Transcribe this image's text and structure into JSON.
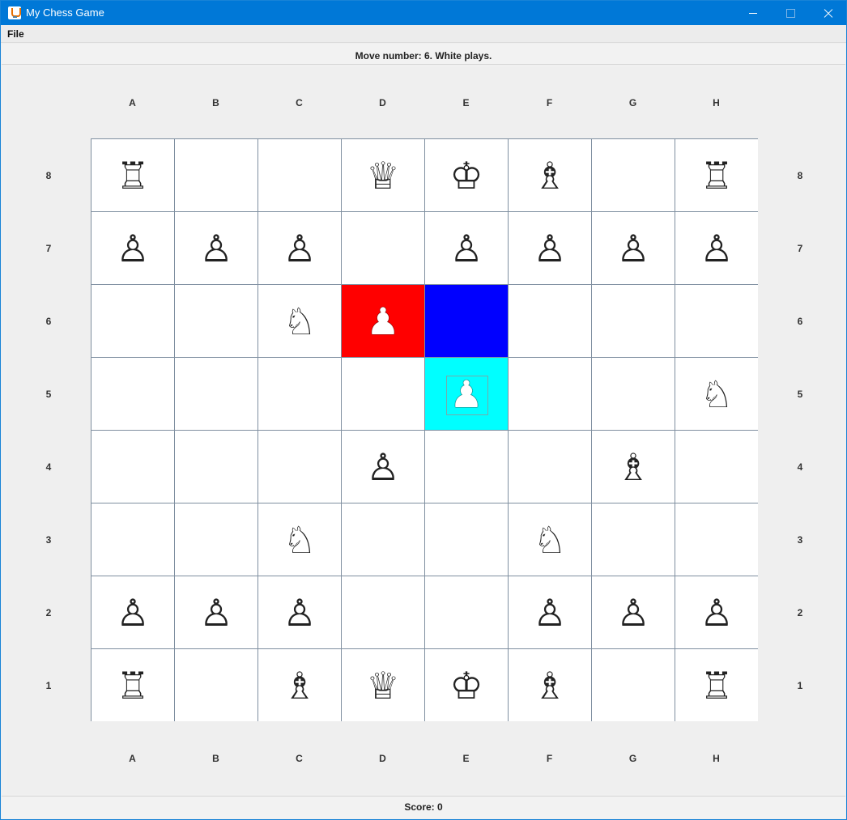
{
  "window": {
    "title": "My Chess Game"
  },
  "menu": {
    "file": "File"
  },
  "status": {
    "move": "Move number: 6. White plays.",
    "score": "Score: 0"
  },
  "board": {
    "columns": [
      "A",
      "B",
      "C",
      "D",
      "E",
      "F",
      "G",
      "H"
    ],
    "rows": [
      "8",
      "7",
      "6",
      "5",
      "4",
      "3",
      "2",
      "1"
    ],
    "highlight_colors": {
      "selected": "#ff0000",
      "target": "#0000ff",
      "threatened": "#00ffff"
    },
    "squares": [
      {
        "sq": "A8",
        "piece": "rook",
        "glyph": "♖"
      },
      {
        "sq": "D8",
        "piece": "queen",
        "glyph": "♕"
      },
      {
        "sq": "E8",
        "piece": "king",
        "glyph": "♔"
      },
      {
        "sq": "F8",
        "piece": "bishop",
        "glyph": "♗"
      },
      {
        "sq": "H8",
        "piece": "rook",
        "glyph": "♖"
      },
      {
        "sq": "A7",
        "piece": "pawn",
        "glyph": "♙"
      },
      {
        "sq": "B7",
        "piece": "pawn",
        "glyph": "♙"
      },
      {
        "sq": "C7",
        "piece": "pawn",
        "glyph": "♙"
      },
      {
        "sq": "E7",
        "piece": "pawn",
        "glyph": "♙"
      },
      {
        "sq": "F7",
        "piece": "pawn",
        "glyph": "♙"
      },
      {
        "sq": "G7",
        "piece": "pawn",
        "glyph": "♙"
      },
      {
        "sq": "H7",
        "piece": "pawn",
        "glyph": "♙"
      },
      {
        "sq": "C6",
        "piece": "knight",
        "glyph": "♘"
      },
      {
        "sq": "D6",
        "piece": "pawn",
        "glyph": "♟",
        "highlight": "selected"
      },
      {
        "sq": "E6",
        "piece": "",
        "glyph": "",
        "highlight": "target"
      },
      {
        "sq": "E5",
        "piece": "pawn",
        "glyph": "♟",
        "highlight": "threatened"
      },
      {
        "sq": "H5",
        "piece": "knight",
        "glyph": "♘"
      },
      {
        "sq": "D4",
        "piece": "pawn",
        "glyph": "♙"
      },
      {
        "sq": "G4",
        "piece": "bishop",
        "glyph": "♗"
      },
      {
        "sq": "C3",
        "piece": "knight",
        "glyph": "♘"
      },
      {
        "sq": "F3",
        "piece": "knight",
        "glyph": "♘"
      },
      {
        "sq": "A2",
        "piece": "pawn",
        "glyph": "♙"
      },
      {
        "sq": "B2",
        "piece": "pawn",
        "glyph": "♙"
      },
      {
        "sq": "C2",
        "piece": "pawn",
        "glyph": "♙"
      },
      {
        "sq": "F2",
        "piece": "pawn",
        "glyph": "♙"
      },
      {
        "sq": "G2",
        "piece": "pawn",
        "glyph": "♙"
      },
      {
        "sq": "H2",
        "piece": "pawn",
        "glyph": "♙"
      },
      {
        "sq": "A1",
        "piece": "rook",
        "glyph": "♖"
      },
      {
        "sq": "C1",
        "piece": "bishop",
        "glyph": "♗"
      },
      {
        "sq": "D1",
        "piece": "queen",
        "glyph": "♕"
      },
      {
        "sq": "E1",
        "piece": "king",
        "glyph": "♔"
      },
      {
        "sq": "F1",
        "piece": "bishop",
        "glyph": "♗"
      },
      {
        "sq": "H1",
        "piece": "rook",
        "glyph": "♖"
      }
    ]
  }
}
